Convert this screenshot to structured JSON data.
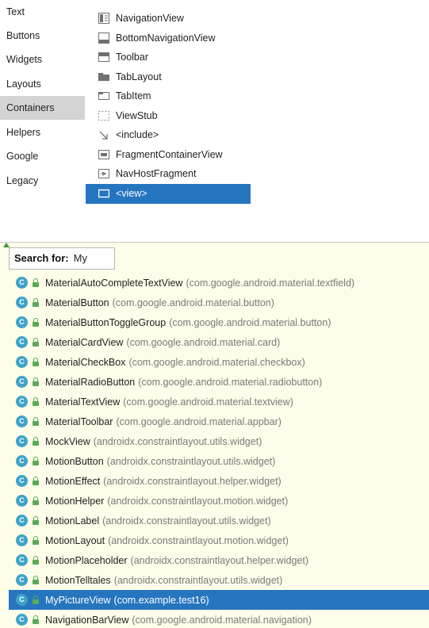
{
  "palette": {
    "categories": [
      {
        "label": "Text"
      },
      {
        "label": "Buttons"
      },
      {
        "label": "Widgets"
      },
      {
        "label": "Layouts"
      },
      {
        "label": "Containers",
        "selected": true
      },
      {
        "label": "Helpers"
      },
      {
        "label": "Google"
      },
      {
        "label": "Legacy"
      }
    ],
    "items": [
      {
        "label": "NavigationView",
        "icon": "navigation-view-icon"
      },
      {
        "label": "BottomNavigationView",
        "icon": "bottom-navigation-icon"
      },
      {
        "label": "Toolbar",
        "icon": "toolbar-icon"
      },
      {
        "label": "TabLayout",
        "icon": "tab-layout-icon"
      },
      {
        "label": "TabItem",
        "icon": "tab-item-icon"
      },
      {
        "label": "ViewStub",
        "icon": "view-stub-icon"
      },
      {
        "label": "<include>",
        "icon": "include-arrow-icon"
      },
      {
        "label": "FragmentContainerView",
        "icon": "fragment-container-icon"
      },
      {
        "label": "NavHostFragment",
        "icon": "nav-host-icon"
      },
      {
        "label": "<view>",
        "icon": "view-icon",
        "selected": true
      }
    ]
  },
  "search": {
    "label": "Search for:",
    "query": "My"
  },
  "results": [
    {
      "name": "MaterialAutoCompleteTextView",
      "package": "(com.google.android.material.textfield)"
    },
    {
      "name": "MaterialButton",
      "package": "(com.google.android.material.button)"
    },
    {
      "name": "MaterialButtonToggleGroup",
      "package": "(com.google.android.material.button)"
    },
    {
      "name": "MaterialCardView",
      "package": "(com.google.android.material.card)"
    },
    {
      "name": "MaterialCheckBox",
      "package": "(com.google.android.material.checkbox)"
    },
    {
      "name": "MaterialRadioButton",
      "package": "(com.google.android.material.radiobutton)"
    },
    {
      "name": "MaterialTextView",
      "package": "(com.google.android.material.textview)"
    },
    {
      "name": "MaterialToolbar",
      "package": "(com.google.android.material.appbar)"
    },
    {
      "name": "MockView",
      "package": "(androidx.constraintlayout.utils.widget)"
    },
    {
      "name": "MotionButton",
      "package": "(androidx.constraintlayout.utils.widget)"
    },
    {
      "name": "MotionEffect",
      "package": "(androidx.constraintlayout.helper.widget)"
    },
    {
      "name": "MotionHelper",
      "package": "(androidx.constraintlayout.motion.widget)"
    },
    {
      "name": "MotionLabel",
      "package": "(androidx.constraintlayout.utils.widget)"
    },
    {
      "name": "MotionLayout",
      "package": "(androidx.constraintlayout.motion.widget)"
    },
    {
      "name": "MotionPlaceholder",
      "package": "(androidx.constraintlayout.helper.widget)"
    },
    {
      "name": "MotionTelltales",
      "package": "(androidx.constraintlayout.utils.widget)"
    },
    {
      "name": "MyPictureView",
      "package": "(com.example.test16)",
      "selected": true
    },
    {
      "name": "NavigationBarView",
      "package": "(com.google.android.material.navigation)"
    }
  ],
  "class_icon_letter": "C",
  "colors": {
    "selection": "#2675bf",
    "popup_background": "#fdfde9",
    "class_icon": "#3ea3c9",
    "lock_icon": "#5aa957",
    "package_text": "#7a7a7a",
    "category_selected": "#d4d4d4"
  }
}
